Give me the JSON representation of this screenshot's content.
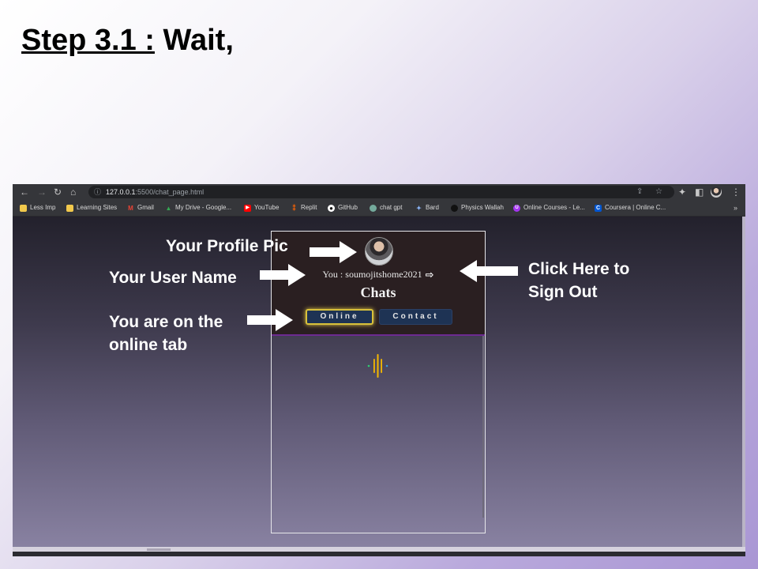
{
  "slide": {
    "title_underlined": "Step 3.1 :",
    "title_rest": " Wait,"
  },
  "browser": {
    "url_host": "127.0.0.1",
    "url_path": ":5500/chat_page.html",
    "bookmarks": [
      {
        "label": "Less Imp",
        "icon": "folder-icon",
        "color": "#f2c94c"
      },
      {
        "label": "Learning Sites",
        "icon": "folder-icon",
        "color": "#f2c94c"
      },
      {
        "label": "Gmail",
        "icon": "gmail-icon",
        "color": "#ea4335"
      },
      {
        "label": "My Drive - Google...",
        "icon": "drive-icon",
        "color": "#34a853"
      },
      {
        "label": "YouTube",
        "icon": "youtube-icon",
        "color": "#ff0000"
      },
      {
        "label": "Replit",
        "icon": "replit-icon",
        "color": "#f26207"
      },
      {
        "label": "GitHub",
        "icon": "github-icon",
        "color": "#ffffff"
      },
      {
        "label": "chat gpt",
        "icon": "chatgpt-icon",
        "color": "#74aa9c"
      },
      {
        "label": "Bard",
        "icon": "bard-icon",
        "color": "#8ab4f8"
      },
      {
        "label": "Physics Wallah",
        "icon": "pw-icon",
        "color": "#111111"
      },
      {
        "label": "Online Courses - Le...",
        "icon": "udemy-icon",
        "color": "#a435f0"
      },
      {
        "label": "Coursera | Online C...",
        "icon": "coursera-icon",
        "color": "#0056d2"
      }
    ],
    "bookmarks_more": "»"
  },
  "chat": {
    "user_line": "You : soumojitshome2021",
    "title": "Chats",
    "tab_online": "Online",
    "tab_contact": "Contact",
    "loader_colors": [
      "#f5b800",
      "#2ecc71",
      "#3498db"
    ]
  },
  "annotations": {
    "profile_pic": "Your Profile Pic",
    "user_name": "Your User Name",
    "sign_out_1": "Click Here to",
    "sign_out_2": "Sign Out",
    "online_tab_1": "You are on the",
    "online_tab_2": "online tab"
  }
}
